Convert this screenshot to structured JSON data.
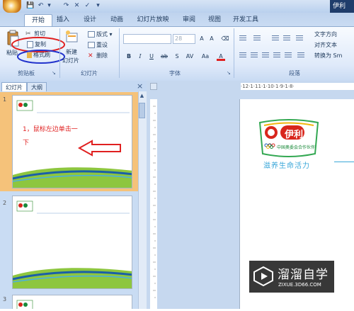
{
  "titlebar": {
    "right_text": "伊利"
  },
  "tabs": [
    "开始",
    "插入",
    "设计",
    "动画",
    "幻灯片放映",
    "审阅",
    "视图",
    "开发工具"
  ],
  "ribbon": {
    "clipboard": {
      "paste": "粘贴",
      "cut": "剪切",
      "copy": "复制",
      "format_painter": "格式刷",
      "label": "剪贴板"
    },
    "slides": {
      "new_slide": "新建",
      "new_slide2": "幻灯片",
      "layout": "版式",
      "reset": "重设",
      "delete": "删除",
      "label": "幻灯片"
    },
    "font": {
      "font_name": "",
      "font_size": "28",
      "label": "字体"
    },
    "paragraph": {
      "text_direction": "文字方向",
      "align_text": "对齐文本",
      "convert_smartart": "转换为 Sm",
      "label": "段落"
    }
  },
  "panel": {
    "tab_slides": "幻灯片",
    "tab_outline": "大纲",
    "close": "×"
  },
  "slides": [
    {
      "num": "1",
      "annotation_line1": "1，鼠标左边单击一",
      "annotation_line2": "下"
    },
    {
      "num": "2"
    },
    {
      "num": "3"
    }
  ],
  "ruler": {
    "text": "·12·1·11·1·10·1·9·1·8·"
  },
  "main": {
    "brand": "伊利",
    "partner": "中国奥委会合作伙伴",
    "slogan": "滋养生命活力"
  },
  "watermark": {
    "name": "溜溜自学",
    "url": "ZIXUE.3D66.COM"
  },
  "colors": {
    "annotation_red": "#e02020",
    "highlight_blue": "#2233cc",
    "brand_green": "#1a8a3a",
    "brand_red": "#d8261c"
  }
}
